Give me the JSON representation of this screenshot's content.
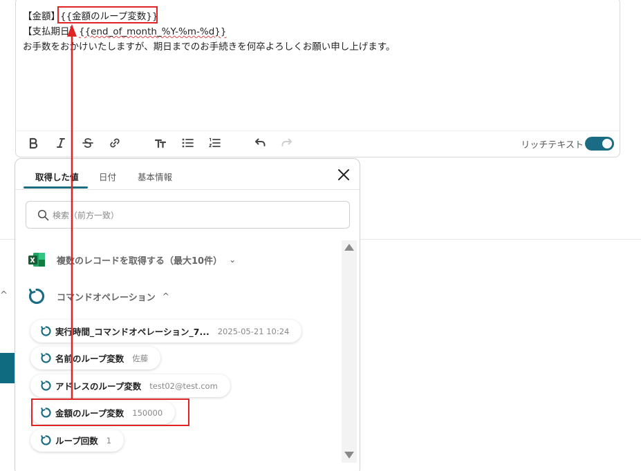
{
  "editor": {
    "line1_prefix": "【金額】",
    "line1_var": "{{金額のループ変数}}",
    "line2_prefix": "【支払期日】",
    "line2_var": "{{end_of_month_%Y-%m-%d}}",
    "line3": "お手数をおかけいたしますが、期日までのお手続きを何卒よろしくお願い申し上げます。"
  },
  "toolbar": {
    "icons": [
      "bold-icon",
      "italic-icon",
      "strikethrough-icon",
      "link-icon",
      "font-size-icon",
      "bullet-list-icon",
      "numbered-list-icon",
      "undo-icon",
      "redo-icon"
    ],
    "rich_text_label": "リッチテキスト",
    "rich_text_enabled": true
  },
  "panel": {
    "tabs": [
      {
        "label": "取得した値",
        "active": true
      },
      {
        "label": "日付",
        "active": false
      },
      {
        "label": "基本情報",
        "active": false
      }
    ],
    "search": {
      "placeholder": "検索（前方一致）",
      "value": ""
    },
    "sections": [
      {
        "label": "複数のレコードを取得する（最大10件）",
        "expanded": false,
        "icon": "excel-icon"
      },
      {
        "label": "コマンドオペレーション",
        "expanded": true,
        "icon": "loop-operation-icon"
      }
    ],
    "items": [
      {
        "label": "実行時間_コマンドオペレーション_7...",
        "value": "2025-05-21 10:24"
      },
      {
        "label": "名前のループ変数",
        "value": "佐藤"
      },
      {
        "label": "アドレスのループ変数",
        "value": "test02@test.com"
      },
      {
        "label": "金額のループ変数",
        "value": "150000",
        "highlighted": true
      },
      {
        "label": "ループ回数",
        "value": "1"
      }
    ]
  },
  "colors": {
    "accent": "#1a6c84",
    "annotation": "#e02424",
    "excel_green": "#1e7a43"
  }
}
